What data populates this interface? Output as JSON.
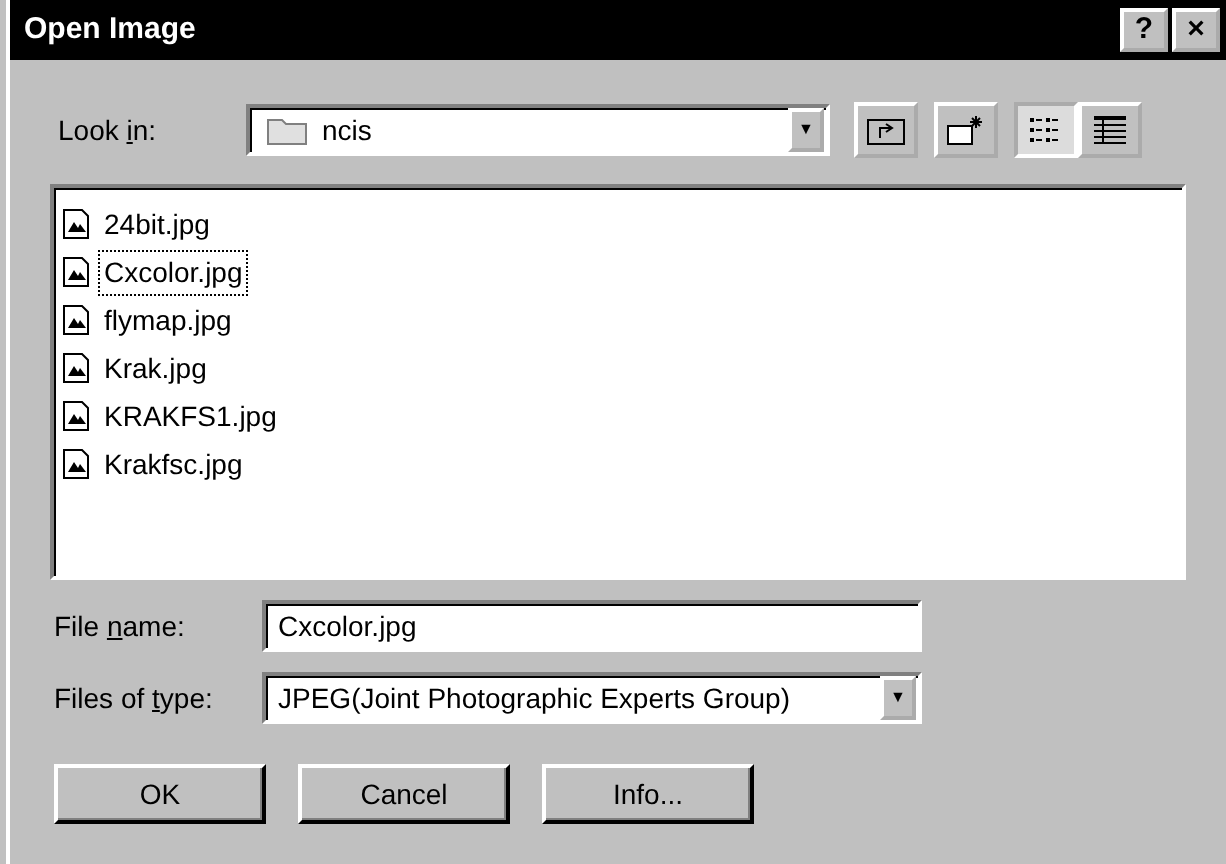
{
  "window": {
    "title": "Open Image",
    "help_button": "?",
    "close_button": "×"
  },
  "look_in": {
    "label": [
      {
        "text": "Look ",
        "underline": false
      },
      {
        "text": "i",
        "underline": true
      },
      {
        "text": "n:",
        "underline": false
      }
    ],
    "value": "ncis",
    "arrow": "▼"
  },
  "files": [
    {
      "name": "24bit.jpg",
      "focused": false
    },
    {
      "name": "Cxcolor.jpg",
      "focused": true
    },
    {
      "name": "flymap.jpg",
      "focused": false
    },
    {
      "name": "Krak.jpg",
      "focused": false
    },
    {
      "name": "KRAKFS1.jpg",
      "focused": false
    },
    {
      "name": "Krakfsc.jpg",
      "focused": false
    }
  ],
  "file_name": {
    "label": [
      {
        "text": "File ",
        "underline": false
      },
      {
        "text": "n",
        "underline": true
      },
      {
        "text": "ame:",
        "underline": false
      }
    ],
    "value": "Cxcolor.jpg"
  },
  "file_type": {
    "label": [
      {
        "text": "Files of ",
        "underline": false
      },
      {
        "text": "t",
        "underline": true
      },
      {
        "text": "ype:",
        "underline": false
      }
    ],
    "value": "JPEG(Joint Photographic Experts Group)",
    "arrow": "▼"
  },
  "buttons": [
    "OK",
    "Cancel",
    "Info..."
  ]
}
